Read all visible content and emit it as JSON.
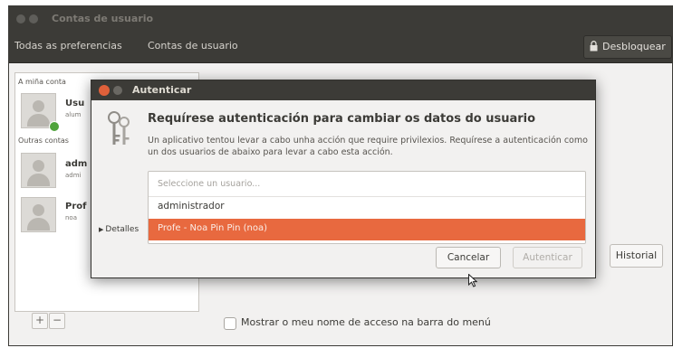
{
  "window": {
    "title": "Contas de usuario",
    "breadcrumbs": [
      "Todas as preferencias",
      "Contas de usuario"
    ],
    "unlock_label": "Desbloquear"
  },
  "sidebar": {
    "my_account_label": "A miña conta",
    "other_accounts_label": "Outras contas",
    "users": [
      {
        "name": "Usu",
        "subtitle": "alum"
      },
      {
        "name": "adm",
        "subtitle": "admi"
      },
      {
        "name": "Prof",
        "subtitle": "noa"
      }
    ],
    "add_label": "+",
    "remove_label": "−"
  },
  "main": {
    "history_button": "Historial",
    "show_login_label": "Mostrar o meu nome de acceso na barra do menú"
  },
  "dialog": {
    "title": "Autenticar",
    "heading": "Requírese autenticación para cambiar os datos do usuario",
    "description": "Un aplicativo tentou levar a cabo unha acción que require privilexios. Requírese a autenticación como un dos usuarios de abaixo para levar a cabo esta acción.",
    "dropdown_placeholder": "Seleccione un usuario...",
    "options": [
      "administrador",
      "Profe - Noa Pin Pin (noa)"
    ],
    "selected_index": 1,
    "details_label": "Detalles",
    "cancel_label": "Cancelar",
    "authenticate_label": "Autenticar"
  },
  "colors": {
    "titlebar": "#3c3b37",
    "accent": "#e8693f",
    "close": "#e0603a"
  }
}
